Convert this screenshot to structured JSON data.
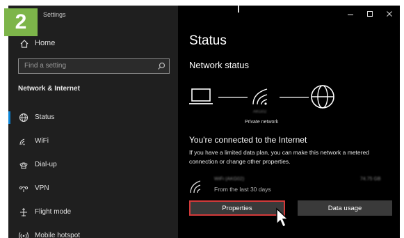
{
  "step_badge": "2",
  "window": {
    "title": "Settings"
  },
  "sidebar": {
    "home_label": "Home",
    "search_placeholder": "Find a setting",
    "section_title": "Network & Internet",
    "items": [
      {
        "label": "Status",
        "icon": "globe-status-icon",
        "selected": true
      },
      {
        "label": "WiFi",
        "icon": "wifi-icon",
        "selected": false
      },
      {
        "label": "Dial-up",
        "icon": "phone-icon",
        "selected": false
      },
      {
        "label": "VPN",
        "icon": "vpn-icon",
        "selected": false
      },
      {
        "label": "Flight mode",
        "icon": "airplane-icon",
        "selected": false
      },
      {
        "label": "Mobile hotspot",
        "icon": "hotspot-icon",
        "selected": false
      }
    ]
  },
  "main": {
    "title": "Status",
    "network_status_heading": "Network status",
    "network_name": "AKG02",
    "private_network_label": "Private network",
    "connected_heading": "You're connected to the Internet",
    "description": "If you have a limited data plan, you can make this network a metered connection or change other properties.",
    "connection": {
      "name": "WiFi (AKG02)",
      "period": "From the last 30 days",
      "usage": "74.75 GB"
    },
    "buttons": {
      "properties": "Properties",
      "data_usage": "Data usage"
    }
  },
  "colors": {
    "accent": "#0a84d6",
    "badge": "#7db54a",
    "highlight": "#d33a3a"
  }
}
